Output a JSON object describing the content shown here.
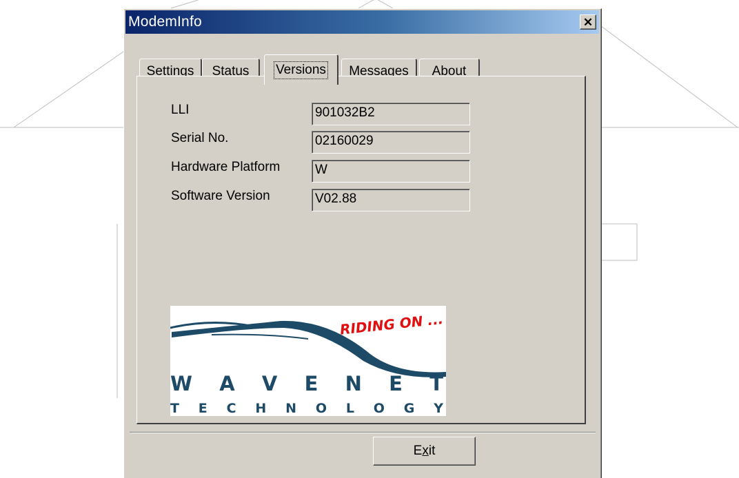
{
  "window": {
    "title": "ModemInfo"
  },
  "tabs": [
    {
      "label": "Settings",
      "active": false
    },
    {
      "label": "Status",
      "active": false
    },
    {
      "label": "Versions",
      "active": true
    },
    {
      "label": "Messages",
      "active": false
    },
    {
      "label": "About",
      "active": false
    }
  ],
  "fields": [
    {
      "label": "LLI",
      "value": "901032B2"
    },
    {
      "label": "Serial No.",
      "value": "02160029"
    },
    {
      "label": "Hardware Platform",
      "value": "W"
    },
    {
      "label": "Software Version",
      "value": "V02.88"
    }
  ],
  "logo": {
    "tagline": "RIDING ON ...",
    "name": "W A V E N E T",
    "subname": "T E C H N O L O G Y"
  },
  "exit_button": {
    "label_before": "E",
    "mnemonic": "x",
    "label_after": "it"
  },
  "colors": {
    "face": "#d4d0c8",
    "title_start": "#0a246a",
    "title_end": "#a6caf0",
    "logo_navy": "#1d4a66",
    "logo_red": "#e01010"
  }
}
